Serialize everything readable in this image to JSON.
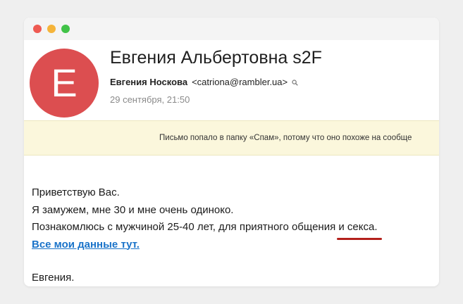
{
  "window": {
    "controls": [
      "close",
      "minimize",
      "maximize"
    ]
  },
  "email": {
    "avatar_letter": "E",
    "subject": "Евгения Альбертовна s2F",
    "sender_name": "Евгения Носкова",
    "sender_email": "<catriona@rambler.ua>",
    "date": "29 сентября, 21:50",
    "spam_notice": "Письмо попало в папку «Спам», потому что оно похоже на сообще",
    "body": {
      "line1": "Приветствую Вас.",
      "line2": "Я замужем, мне 30 и мне очень одиноко.",
      "line3_prefix": "Познакомлюсь с мужчиной 25-40 лет, для приятного общения ",
      "line3_highlight": "и секса.",
      "link": "Все мои данные тут.",
      "signature": "Евгения."
    }
  },
  "colors": {
    "avatar": "#dc4e50",
    "link": "#1a73c9",
    "spam_banner": "#fbf7dc",
    "annotation_underline": "#b3201b"
  },
  "icons": {
    "sender_search": "search-icon"
  }
}
